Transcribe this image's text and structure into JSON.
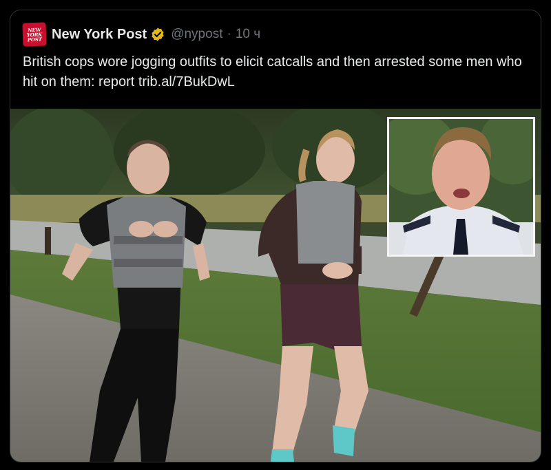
{
  "tweet": {
    "author_name": "New York Post",
    "handle": "@nypost",
    "separator": "·",
    "time": "10 ч",
    "avatar_text": [
      "NEW",
      "YORK",
      "POST"
    ],
    "text": "British cops wore jogging outfits to elicit catcalls and then arrested some men who hit on them: report trib.al/7BukDwL",
    "verified_icon": "gold-verified-badge-icon",
    "colors": {
      "background": "#000000",
      "text": "#e7e9ea",
      "muted": "#71767b",
      "border": "#2f3336",
      "verified_gold": "#e2b719",
      "avatar_red": "#c8102e"
    }
  },
  "media": {
    "main_photo": "photo of two women jogging on a gravel path in a park",
    "inset_photo": "photo of a uniformed police officer speaking"
  }
}
